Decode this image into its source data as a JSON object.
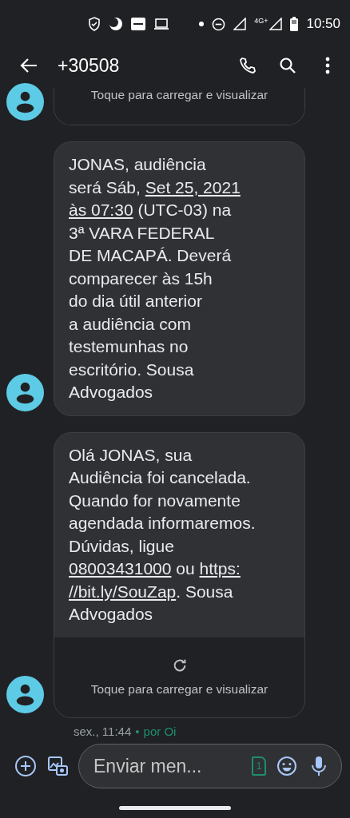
{
  "status_bar": {
    "network": "4G+",
    "time": "10:50"
  },
  "header": {
    "title": "+30508"
  },
  "messages": [
    {
      "kind": "attachment",
      "attachment_label": "Toque para carregar e visualizar"
    },
    {
      "kind": "text",
      "segments": [
        {
          "text": "JONAS, audiência\nserá Sáb, ",
          "link": false
        },
        {
          "text": "Set 25, 2021",
          "link": true
        },
        {
          "text": "às 07:30",
          "link": true
        },
        {
          "text": " (UTC-03) na\n3ª VARA FEDERAL\nDE MACAPÁ. Deverá\ncomparecer às 15h\ndo dia útil anterior\na audiência com\ntestemunhas no\nescritório. Sousa\nAdvogados",
          "link": false
        }
      ]
    },
    {
      "kind": "text_attachment",
      "segments": [
        {
          "text": "Olá JONAS, sua\nAudiência foi cancelada.\nQuando for novamente\nagendada informaremos.\nDúvidas, ligue\n",
          "link": false
        },
        {
          "text": "08003431000",
          "link": true
        },
        {
          "text": " ou ",
          "link": false
        },
        {
          "text": "https:",
          "link": true
        },
        {
          "text": "//bit.ly/SouZap",
          "link": true
        },
        {
          "text": ". Sousa\nAdvogados",
          "link": false
        }
      ],
      "attachment_label": "Toque para carregar e visualizar"
    }
  ],
  "footer": {
    "time": "sex., 11:44",
    "separator": "•",
    "carrier": "por Oi"
  },
  "composer": {
    "placeholder": "Enviar men...",
    "sim_slot": "1"
  }
}
